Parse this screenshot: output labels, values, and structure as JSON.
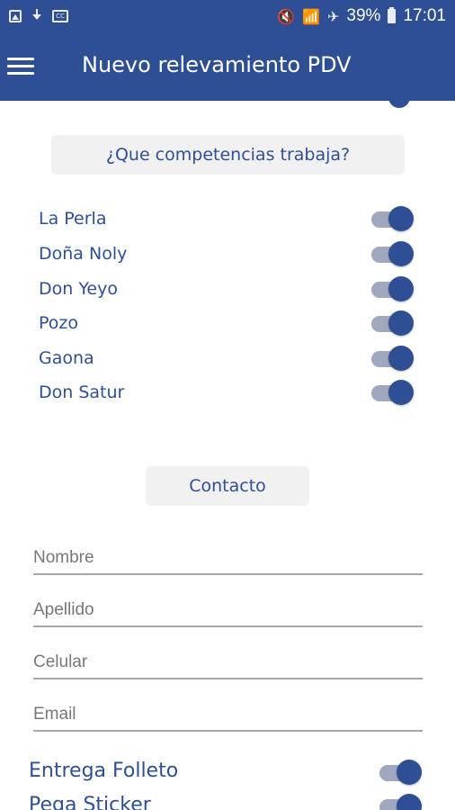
{
  "status_bar": {
    "battery_percent": "39%",
    "time": "17:01",
    "left_icons": [
      "image-icon",
      "download-icon",
      "cc-icon"
    ],
    "right_icons": [
      "mute-icon",
      "wifi-icon",
      "airplane-icon",
      "battery-icon"
    ],
    "cc_text": "CC"
  },
  "app_bar": {
    "title": "Nuevo relevamiento PDV",
    "menu_icon": "hamburger-icon"
  },
  "competencias": {
    "header": "¿Que competencias trabaja?",
    "items": [
      {
        "label": "La Perla",
        "on": true
      },
      {
        "label": "Doña Noly",
        "on": true
      },
      {
        "label": "Don Yeyo",
        "on": true
      },
      {
        "label": "Pozo",
        "on": true
      },
      {
        "label": "Gaona",
        "on": true
      },
      {
        "label": "Don Satur",
        "on": true
      }
    ]
  },
  "contacto": {
    "header": "Contacto",
    "fields": [
      {
        "placeholder": "Nombre",
        "value": ""
      },
      {
        "placeholder": "Apellido",
        "value": ""
      },
      {
        "placeholder": "Celular",
        "value": ""
      },
      {
        "placeholder": "Email",
        "value": ""
      }
    ]
  },
  "extras": [
    {
      "label": "Entrega Folleto",
      "on": true
    },
    {
      "label": "Pega Sticker",
      "on": true
    }
  ],
  "colors": {
    "primary": "#2f4f94",
    "toggle_track": "#9fa8be",
    "button_bg": "#f1f1f1"
  }
}
